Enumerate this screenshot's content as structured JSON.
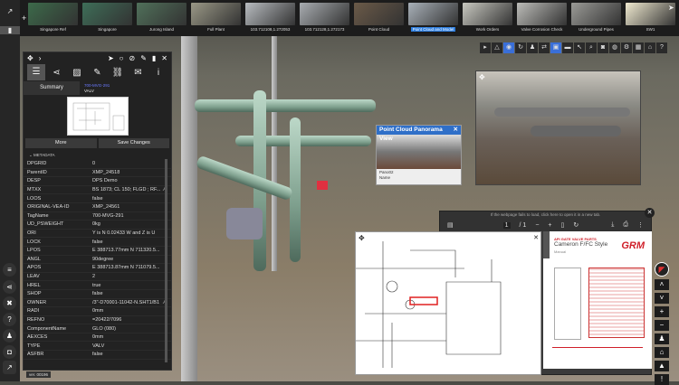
{
  "thumbnails": [
    {
      "label": "Singapore Ref",
      "color": "#3c6a4a"
    },
    {
      "label": "Singapore",
      "color": "#3e6e58"
    },
    {
      "label": "Jurong Island",
      "color": "#50705a"
    },
    {
      "label": "Full Plant",
      "color": "#9a9886"
    },
    {
      "label": "103.712108,1.272053",
      "color": "#b8bcc0"
    },
    {
      "label": "103.712128,1.272173",
      "color": "#a8acb0"
    },
    {
      "label": "Point Cloud",
      "color": "#6b5a48"
    },
    {
      "label": "Point Cloud and Model",
      "color": "#a8b0b8",
      "selected": true
    },
    {
      "label": "Work Orders",
      "color": "#c8c8c0"
    },
    {
      "label": "Valve Corrosion Check",
      "color": "#bcbcb8"
    },
    {
      "label": "Underground Pipes",
      "color": "#9a9a96"
    },
    {
      "label": "SW1",
      "color": "#f0ead0"
    }
  ],
  "panel": {
    "summary_tab": "Summary",
    "tag_link": "700-MVG-291",
    "tag_type": "VALV",
    "more_button": "More",
    "save_button": "Save Changes",
    "metadata_header": "METADATA",
    "rows": [
      {
        "k": "DPGRID",
        "v": "0"
      },
      {
        "k": "ParentID",
        "v": "XMP_24518"
      },
      {
        "k": "DESP",
        "v": "DPS Demo"
      },
      {
        "k": "MTXX",
        "v": "BS 1873; CL 150; FLGD ; RF...",
        "edit": true
      },
      {
        "k": "LOOS",
        "v": "false"
      },
      {
        "k": "ORIGINAL-VEA-ID",
        "v": "XMP_24561"
      },
      {
        "k": "TagName",
        "v": "700-MVG-291"
      },
      {
        "k": "UD_PSWEIGHT",
        "v": "0kg"
      },
      {
        "k": "ORI",
        "v": "Y is N 0.02433 W and Z is U"
      },
      {
        "k": "LOCK",
        "v": "false"
      },
      {
        "k": "LPOS",
        "v": "E 388713.77mm N 711320.5..."
      },
      {
        "k": "ANGL",
        "v": "90degree"
      },
      {
        "k": "APOS",
        "v": "E 388713.87mm N 711079.5..."
      },
      {
        "k": "LEAV",
        "v": "2"
      },
      {
        "k": "HREL",
        "v": "true"
      },
      {
        "k": "SHOP",
        "v": "false"
      },
      {
        "k": "OWNER",
        "v": "/3\"-D70001-11042-N.SHT1/B1",
        "edit": true
      },
      {
        "k": "RADI",
        "v": "0mm"
      },
      {
        "k": "REFNO",
        "v": "=20422/7096"
      },
      {
        "k": "ComponentName",
        "v": "GLO (080)"
      },
      {
        "k": "AEXCES",
        "v": "0mm"
      },
      {
        "k": "TYPE",
        "v": "VALV"
      },
      {
        "k": "ASFBR",
        "v": "false"
      }
    ]
  },
  "panorama": {
    "title": "Point Cloud Panorama View",
    "line1": "Pano02",
    "line2": "Name"
  },
  "pdf": {
    "hint": "If the webpage fails to load, click here to open it in a new tab.",
    "page": "1",
    "total": "/ 1",
    "doc_header": "API GATE VALVE PARTS",
    "doc_title": "Cameron F/FC Style",
    "doc_sub": "Manual",
    "brand": "GRM"
  },
  "version": "ver. 00196",
  "colors": {
    "accent": "#2f7fe0",
    "brand": "#d0202a"
  }
}
